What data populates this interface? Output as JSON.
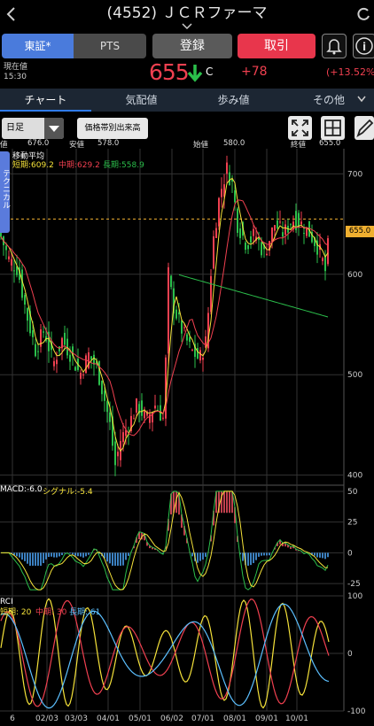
{
  "header": {
    "title": "(4552) ＪＣＲファーマ"
  },
  "buttons": {
    "tosho": "東証*",
    "pts": "PTS",
    "register": "登録",
    "trade": "取引"
  },
  "quote": {
    "label": "現在値",
    "time": "15:30",
    "price": "655",
    "mark": "C",
    "change": "+78",
    "change_pct": "(+13.52%)"
  },
  "tabs": [
    "チャート",
    "気配値",
    "歩み値",
    "その他"
  ],
  "controls": {
    "period": "日足",
    "volume_button": "価格帯別出来高"
  },
  "ohlc": {
    "open_label": "始値",
    "open": "580.0",
    "high_label": "高値",
    "high": "676.0",
    "low_label": "安値",
    "low": "578.0",
    "close_label": "終値",
    "close": "655.0",
    "close_partial_label": "値"
  },
  "overlays": {
    "side_tab": "テクニカル",
    "ma_title": "移動平均",
    "ma_short": "短期:609.2",
    "ma_mid": "中期:629.2",
    "ma_long": "長期:558.9",
    "current_price_tag": "655.0"
  },
  "macd": {
    "label": "MACD:-6.0",
    "signal": "シグナル:-5.4"
  },
  "rci": {
    "label": "RCI",
    "short": "短期: 20",
    "mid": "中期: 30",
    "long": "長期: 61"
  },
  "colors": {
    "accent_blue": "#4a7bdc",
    "trade_red": "#e8364c",
    "down_green": "#2bbf4b",
    "up_red": "#f04050"
  },
  "chart_data": {
    "type": "candlestick",
    "y_ticks_price": [
      "700",
      "600",
      "500",
      "400"
    ],
    "y_ticks_macd": [
      "50",
      "25",
      "0",
      "-25"
    ],
    "y_ticks_rci": [
      "100",
      "0",
      "-100"
    ],
    "x_ticks": [
      "6",
      "02/03",
      "03/03",
      "04/01",
      "05/01",
      "06/02",
      "07/01",
      "08/01",
      "09/01",
      "10/01"
    ],
    "ylim_price": [
      390,
      725
    ],
    "ylim_macd": [
      -35,
      55
    ],
    "ylim_rci": [
      -100,
      100
    ]
  }
}
